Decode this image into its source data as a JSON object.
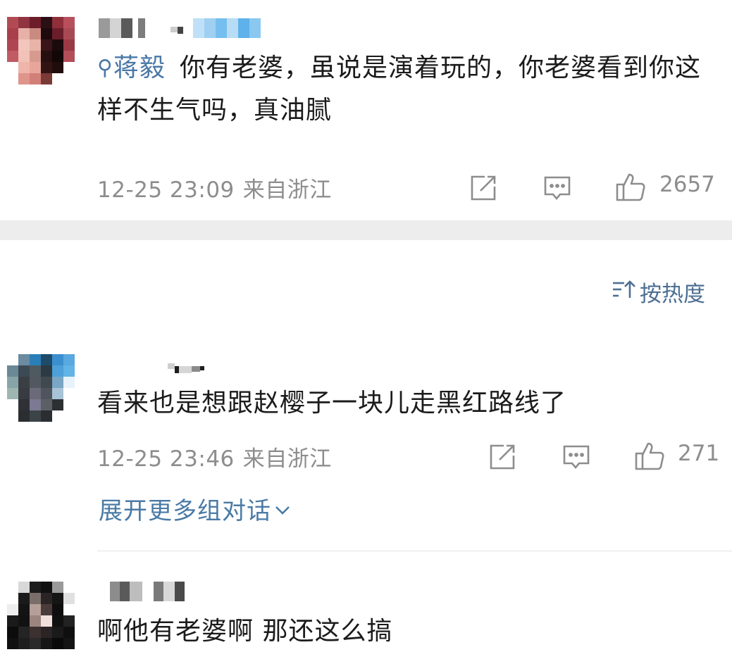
{
  "comments": [
    {
      "mention": "蒋毅",
      "text": "你有老婆，虽说是演着玩的，你老婆看到你这样不生气吗，真油腻",
      "date": "12-25 23:09",
      "location": "来自浙江",
      "likes": "2657"
    },
    {
      "text": "看来也是想跟赵樱子一块儿走黑红路线了",
      "date": "12-25 23:46",
      "location": "来自浙江",
      "likes": "271",
      "expand_label": "展开更多组对话"
    },
    {
      "text": "啊他有老婆啊 那还这么搞"
    }
  ],
  "sort": {
    "label": "按热度",
    "icon": "sort-icon"
  },
  "icons": {
    "share": "share-icon",
    "comment": "comment-icon",
    "like": "thumbs-up-icon",
    "search": "search-icon"
  },
  "colors": {
    "link": "#4a78a6",
    "meta": "#8d8d8d",
    "band": "#ededed",
    "text": "#1b1b1b"
  }
}
